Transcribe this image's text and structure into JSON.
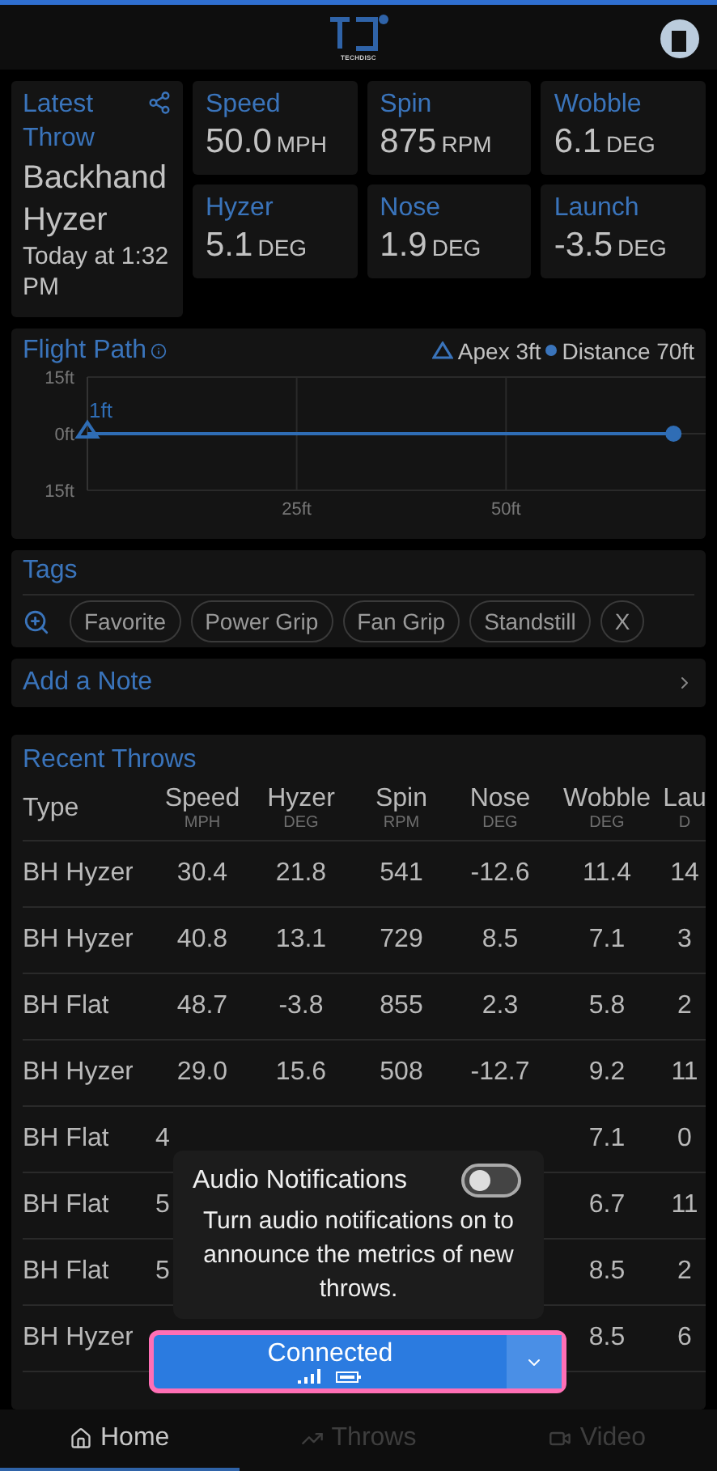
{
  "header": {
    "logo_caption": "TECHDISC"
  },
  "latest": {
    "title": "Latest Throw",
    "throw_type": "Backhand Hyzer",
    "time": "Today at 1:32 PM"
  },
  "metrics": [
    {
      "label": "Speed",
      "value": "50.0",
      "unit": "MPH"
    },
    {
      "label": "Spin",
      "value": "875",
      "unit": "RPM"
    },
    {
      "label": "Wobble",
      "value": "6.1",
      "unit": "DEG"
    },
    {
      "label": "Hyzer",
      "value": "5.1",
      "unit": "DEG"
    },
    {
      "label": "Nose",
      "value": "1.9",
      "unit": "DEG"
    },
    {
      "label": "Launch",
      "value": "-3.5",
      "unit": "DEG"
    }
  ],
  "flight_path": {
    "title": "Flight Path",
    "apex": "Apex 3ft",
    "distance": "Distance 70ft",
    "chart_data": {
      "type": "line",
      "x": [
        0,
        70
      ],
      "grid": true,
      "series": [
        {
          "color": "#2f6db5",
          "marker": "triangle",
          "values": [
            0,
            0
          ]
        }
      ],
      "xlim": [
        0,
        75
      ],
      "ylim": [
        -15,
        15
      ],
      "xticks": [
        {
          "value": 25,
          "label": "25ft"
        },
        {
          "value": 50,
          "label": "50ft"
        }
      ],
      "yticks": [
        {
          "value": 15,
          "label": "15ft"
        },
        {
          "value": 0,
          "label": "0ft"
        },
        {
          "value": -15,
          "label": "15ft"
        }
      ],
      "annotations": [
        "1ft"
      ]
    }
  },
  "tags": {
    "title": "Tags",
    "items": [
      "Favorite",
      "Power Grip",
      "Fan Grip",
      "Standstill",
      "X"
    ]
  },
  "note": {
    "label": "Add a Note"
  },
  "recent": {
    "title": "Recent Throws",
    "columns": [
      {
        "label": "Type"
      },
      {
        "label": "Speed",
        "unit": "MPH"
      },
      {
        "label": "Hyzer",
        "unit": "DEG"
      },
      {
        "label": "Spin",
        "unit": "RPM"
      },
      {
        "label": "Nose",
        "unit": "DEG"
      },
      {
        "label": "Wobble",
        "unit": "DEG"
      },
      {
        "label": "Lau",
        "unit": "D"
      }
    ],
    "rows": [
      {
        "type": "BH Hyzer",
        "speed": "30.4",
        "hyzer": "21.8",
        "spin": "541",
        "nose": "-12.6",
        "wobble": "11.4",
        "launch": "14"
      },
      {
        "type": "BH Hyzer",
        "speed": "40.8",
        "hyzer": "13.1",
        "spin": "729",
        "nose": "8.5",
        "wobble": "7.1",
        "launch": "3"
      },
      {
        "type": "BH Flat",
        "speed": "48.7",
        "hyzer": "-3.8",
        "spin": "855",
        "nose": "2.3",
        "wobble": "5.8",
        "launch": "2"
      },
      {
        "type": "BH Hyzer",
        "speed": "29.0",
        "hyzer": "15.6",
        "spin": "508",
        "nose": "-12.7",
        "wobble": "9.2",
        "launch": "11"
      },
      {
        "type": "BH Flat",
        "speed": "4",
        "wobble": "7.1",
        "launch": "0"
      },
      {
        "type": "BH Flat",
        "speed": "5",
        "wobble": "6.7",
        "launch": "11"
      },
      {
        "type": "BH Flat",
        "speed": "5",
        "wobble": "8.5",
        "launch": "2"
      },
      {
        "type": "BH Hyzer",
        "wobble": "8.5",
        "launch": "6"
      }
    ]
  },
  "audio_popup": {
    "title": "Audio Notifications",
    "on": false,
    "text": "Turn audio notifications on to announce the metrics of new throws."
  },
  "connection": {
    "label": "Connected"
  },
  "nav": [
    {
      "label": "Home",
      "selected": true
    },
    {
      "label": "Throws",
      "selected": false
    },
    {
      "label": "Video",
      "selected": false
    }
  ]
}
